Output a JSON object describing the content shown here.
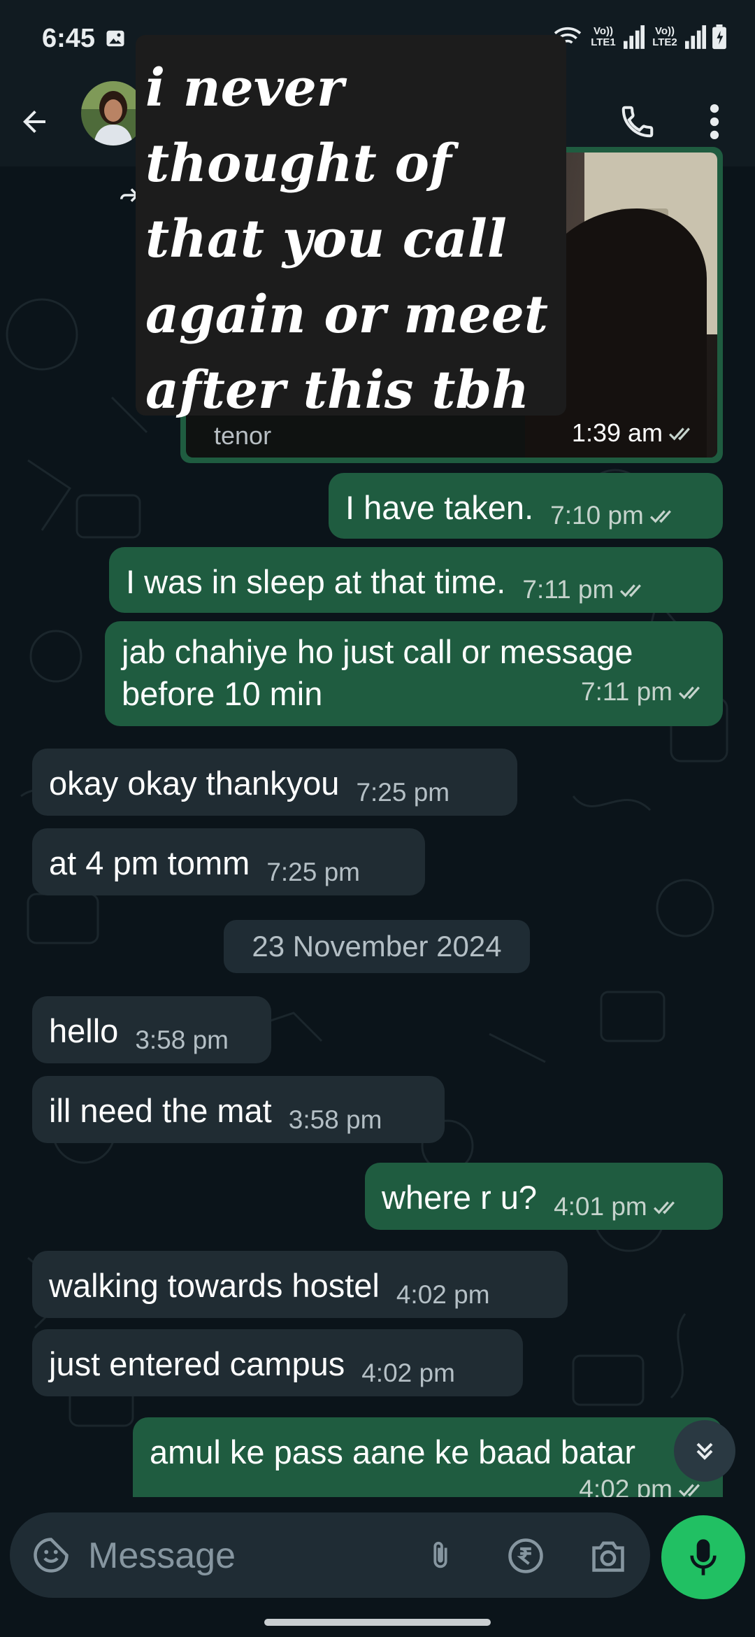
{
  "status_bar": {
    "time": "6:45",
    "network_1": "Vo)) LTE1",
    "network_2": "Vo)) LTE2",
    "icons": [
      "gallery-icon",
      "wifi-icon",
      "signal-icon",
      "signal-icon",
      "battery-icon"
    ]
  },
  "header": {
    "back_icon": "arrow-left-icon",
    "call_icon": "phone-icon",
    "menu_icon": "more-vert-icon"
  },
  "overlay_quote": {
    "lines": [
      "i never",
      "thought of",
      "that you call",
      "again or meet",
      "after this tbh"
    ]
  },
  "gif_message": {
    "source": "tenor",
    "time": "1:39 am",
    "status": "read"
  },
  "messages": [
    {
      "direction": "out",
      "text": "I have taken.",
      "time": "7:10 pm"
    },
    {
      "direction": "out",
      "text": "I was in sleep at that time.",
      "time": "7:11 pm"
    },
    {
      "direction": "out",
      "text_line1": "jab chahiye ho just call or message",
      "text_line2": "before 10 min",
      "time": "7:11 pm"
    },
    {
      "direction": "in",
      "text": "okay okay thankyou",
      "time": "7:25 pm"
    },
    {
      "direction": "in",
      "text": "at 4 pm tomm",
      "time": "7:25 pm"
    },
    {
      "direction": "in",
      "text": "hello",
      "time": "3:58 pm"
    },
    {
      "direction": "in",
      "text": "ill need the mat",
      "time": "3:58 pm"
    },
    {
      "direction": "out",
      "text": "where r u?",
      "time": "4:01 pm"
    },
    {
      "direction": "in",
      "text": "walking towards hostel",
      "time": "4:02 pm"
    },
    {
      "direction": "in",
      "text": "just entered campus",
      "time": "4:02 pm"
    },
    {
      "direction": "out",
      "text": "amul ke pass aane ke baad batar",
      "time": "4:02 pm"
    }
  ],
  "date_divider": "23 November 2024",
  "composer": {
    "placeholder": "Message",
    "icons": [
      "sticker-icon",
      "paperclip-icon",
      "rupee-icon",
      "camera-icon",
      "mic-icon"
    ]
  },
  "colors": {
    "background": "#0b141a",
    "outgoing_bubble": "#1f5c40",
    "incoming_bubble": "#202c33",
    "accent": "#21c063"
  }
}
